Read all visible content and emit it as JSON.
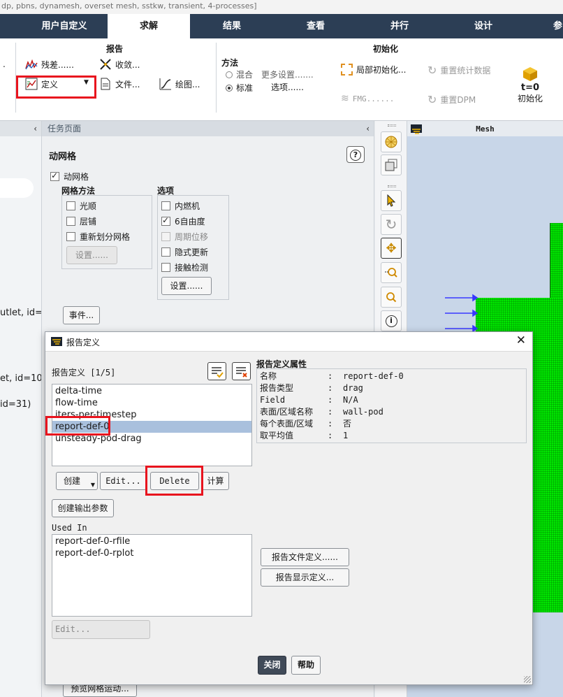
{
  "window_title": "dp, pbns, dynamesh, overset mesh, sstkw, transient, 4-processes]",
  "ribbon_tabs": [
    "用户自定义",
    "求解",
    "结果",
    "查看",
    "并行",
    "设计",
    "参"
  ],
  "ribbon": {
    "report_group_title": "报告",
    "residuals": "残差......",
    "convergence": "收敛...",
    "definitions": "定义",
    "files": "文件...",
    "plots": "绘图...",
    "method_title": "方法",
    "hybrid": "混合",
    "standard": "标准",
    "more_settings": "更多设置.......",
    "options": "选项......",
    "init_group_title": "初始化",
    "local_init": "局部初始化...",
    "reset_stats": "重置统计数据",
    "fmg": "FMG......",
    "reset_dpm": "重置DPM",
    "init_icon_text": "t=0",
    "init_button": "初始化"
  },
  "left_panel": {
    "frag1": "utlet, id=",
    "frag2": "et, id=10",
    "frag3": "id=31)"
  },
  "task_page": {
    "header": "任务页面",
    "title": "动网格",
    "dynamic_mesh_checkbox": "动网格",
    "mesh_methods_title": "网格方法",
    "smoothing": "光顺",
    "layering": "层铺",
    "remeshing": "重新划分网格",
    "mesh_settings": "设置......",
    "options_title": "选项",
    "ic_engine": "内燃机",
    "six_dof": "6自由度",
    "periodic_displacement": "周期位移",
    "implicit_update": "隐式更新",
    "contact_detection": "接触检测",
    "options_settings": "设置......",
    "events": "事件...",
    "preview_mesh_motion": "预览网格运动..."
  },
  "graphics": {
    "title": "Mesh"
  },
  "dialog": {
    "title": "报告定义",
    "list_label": "报告定义 [1/5]",
    "report_defs": [
      "delta-time",
      "flow-time",
      "iters-per-timestep",
      "report-def-0",
      "unsteady-pod-drag"
    ],
    "selected_index": 3,
    "props_title": "报告定义属性",
    "props": [
      {
        "key": "名称",
        "value": "report-def-0"
      },
      {
        "key": "报告类型",
        "value": "drag"
      },
      {
        "key": "Field",
        "value": "N/A"
      },
      {
        "key": "表面/区域名称",
        "value": "wall-pod"
      },
      {
        "key": "每个表面/区域",
        "value": "否"
      },
      {
        "key": "取平均值",
        "value": "1"
      }
    ],
    "create": "创建",
    "edit": "Edit...",
    "delete": "Delete",
    "compute": "计算",
    "create_output_param": "创建输出参数",
    "used_in_label": "Used In",
    "used_in": [
      "report-def-0-rfile",
      "report-def-0-rplot"
    ],
    "used_in_edit": "Edit...",
    "report_file_def": "报告文件定义......",
    "report_plot_def": "报告显示定义...",
    "close": "关闭",
    "help": "帮助"
  },
  "colors": {
    "tabbar": "#2c3e55",
    "highlight_red": "#e8141e",
    "mesh_green": "#00e800",
    "selection": "#a9c0dd"
  }
}
